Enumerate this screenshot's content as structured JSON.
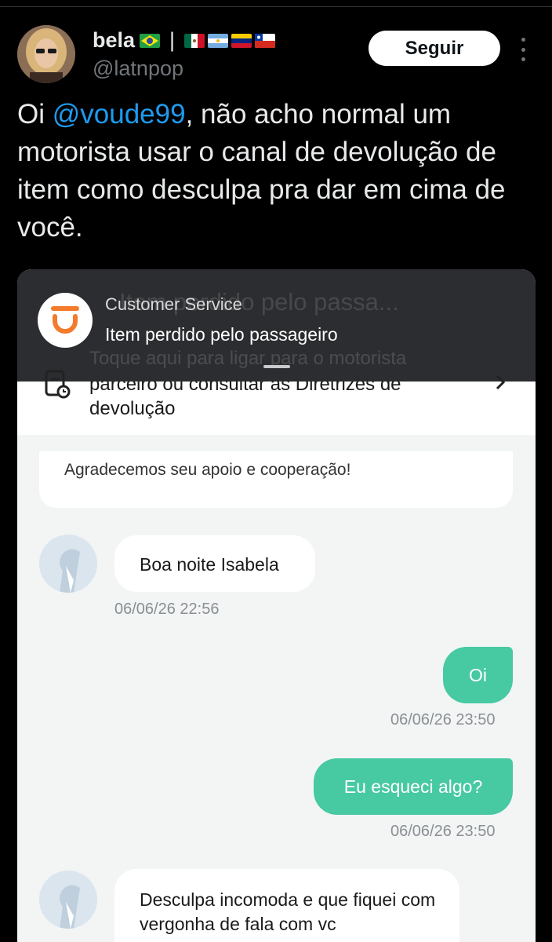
{
  "tweet": {
    "display_name": "bela",
    "handle": "@latnpop",
    "follow_label": "Seguir",
    "text_before": "Oi ",
    "mention": "@voude99",
    "text_after": ", não acho normal um motorista usar o canal de devolução de item como desculpa pra dar em cima de você.",
    "separator": "|"
  },
  "notification": {
    "ghost_line": "Item perdido pelo passa...",
    "ghost_line2": "Toque aqui para ligar para o motorista",
    "title": "Customer Service",
    "body": "Item perdido pelo passageiro",
    "accent": "#f47a2c"
  },
  "banner": {
    "text": "Toque aqui para ligar para o motorista parceiro ou consultar as Diretrizes de devolução"
  },
  "chat": {
    "previous_message": "Agradecemos seu apoio e cooperação!",
    "messages": [
      {
        "from": "agent",
        "text": "Boa noite Isabela",
        "time": "06/06/26 22:56"
      },
      {
        "from": "user",
        "text": "Oi",
        "time": "06/06/26 23:50"
      },
      {
        "from": "user",
        "text": "Eu esqueci algo?",
        "time": "06/06/26 23:50"
      },
      {
        "from": "agent",
        "text": "Desculpa incomoda e que fiquei com vergonha de fala com vc",
        "time": ""
      }
    ],
    "user_bubble_color": "#47c9a2"
  }
}
